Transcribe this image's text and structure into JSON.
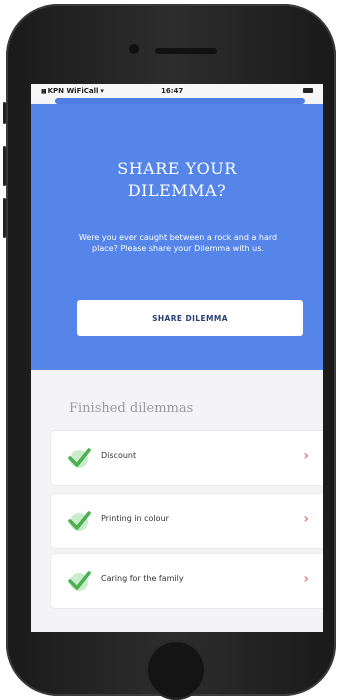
{
  "status_bar": {
    "signal": "▮▮",
    "carrier": "KPN WiFiCall",
    "wifi": "▾",
    "time": "16:47"
  },
  "hero": {
    "title": "SHARE YOUR\nDILEMMA?",
    "text": "Were you ever caught between a rock and a hard place? Please share your Dilemma with us.",
    "button_label": "SHARE DILEMMA"
  },
  "finished": {
    "title": "Finished dilemmas",
    "chevron": "›",
    "items": [
      {
        "label": "Discount"
      },
      {
        "label": "Printing in colour"
      },
      {
        "label": "Caring for the family"
      }
    ]
  },
  "colors": {
    "hero_background": "#5585e8",
    "check_green": "#4caf50",
    "chevron": "#e98080"
  }
}
